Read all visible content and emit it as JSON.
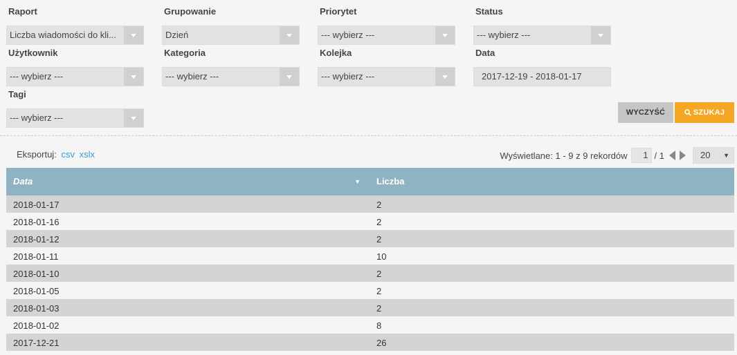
{
  "filters": {
    "raport": {
      "label": "Raport",
      "value": "Liczba wiadomości do kli..."
    },
    "grupowanie": {
      "label": "Grupowanie",
      "value": "Dzień"
    },
    "priorytet": {
      "label": "Priorytet",
      "value": "--- wybierz ---"
    },
    "status": {
      "label": "Status",
      "value": "--- wybierz ---"
    },
    "uzytkownik": {
      "label": "Użytkownik",
      "value": "--- wybierz ---"
    },
    "kategoria": {
      "label": "Kategoria",
      "value": "--- wybierz ---"
    },
    "kolejka": {
      "label": "Kolejka",
      "value": "--- wybierz ---"
    },
    "data": {
      "label": "Data",
      "value": "2017-12-19 - 2018-01-17"
    },
    "tagi": {
      "label": "Tagi",
      "value": "--- wybierz ---"
    }
  },
  "buttons": {
    "clear": "WYCZYŚĆ",
    "search": "SZUKAJ"
  },
  "export": {
    "label": "Eksportuj:",
    "csv": "csv",
    "xslx": "xslx"
  },
  "pager": {
    "info": "Wyświetlane: 1 - 9 z 9 rekordów",
    "page": "1",
    "total": "/ 1",
    "page_size": "20"
  },
  "table": {
    "columns": {
      "date": "Data",
      "count": "Liczba"
    },
    "rows": [
      {
        "date": "2018-01-17",
        "count": "2"
      },
      {
        "date": "2018-01-16",
        "count": "2"
      },
      {
        "date": "2018-01-12",
        "count": "2"
      },
      {
        "date": "2018-01-11",
        "count": "10"
      },
      {
        "date": "2018-01-10",
        "count": "2"
      },
      {
        "date": "2018-01-05",
        "count": "2"
      },
      {
        "date": "2018-01-03",
        "count": "2"
      },
      {
        "date": "2018-01-02",
        "count": "8"
      },
      {
        "date": "2017-12-21",
        "count": "26"
      }
    ]
  },
  "colors": {
    "accent": "#f5a623",
    "table_header": "#8fb3c2",
    "link": "#3a9bd9",
    "row_stripe": "#d4d4d4"
  },
  "icons": {
    "select_caret": "chevron-down-icon",
    "search": "search-icon",
    "prev": "triangle-left-icon",
    "next": "triangle-right-icon",
    "sort": "sort-down-icon"
  }
}
